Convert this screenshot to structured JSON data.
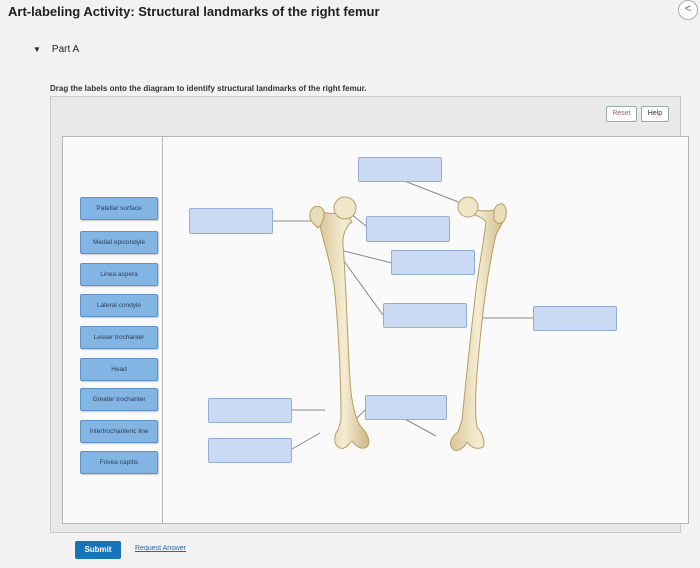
{
  "header": {
    "title": "Art-labeling Activity: Structural landmarks of the right femur",
    "collapse_icon": "<"
  },
  "part": {
    "caret": "▼",
    "label": "Part A"
  },
  "instructions": "Drag the labels onto the diagram to identify structural landmarks of the right femur.",
  "toolbar": {
    "reset_label": "Reset",
    "help_label": "Help"
  },
  "labels": [
    "Patellar surface",
    "Medial epicondyle",
    "Linea aspera",
    "Lateral condyle",
    "Lesser trochanter",
    "Head",
    "Greater trochanter",
    "Intertrochanteric line",
    "Fovea capitis"
  ],
  "actions": {
    "submit_label": "Submit",
    "request_answer_label": "Request Answer"
  }
}
